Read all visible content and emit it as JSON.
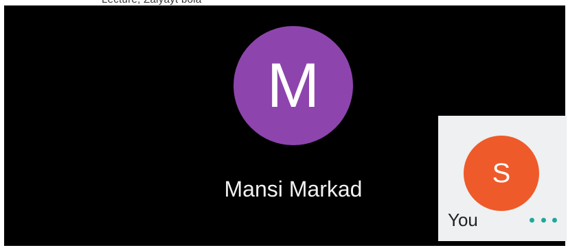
{
  "caption": "Lecture, Zalyayt bola",
  "main_participant": {
    "initial": "M",
    "name": "Mansi Markad",
    "avatar_color": "#8e44ad"
  },
  "self_view": {
    "initial": "S",
    "label": "You",
    "avatar_color": "#ef5a2a",
    "more_icon": "more-horizontal-icon",
    "accent_color": "#1ea89a"
  }
}
